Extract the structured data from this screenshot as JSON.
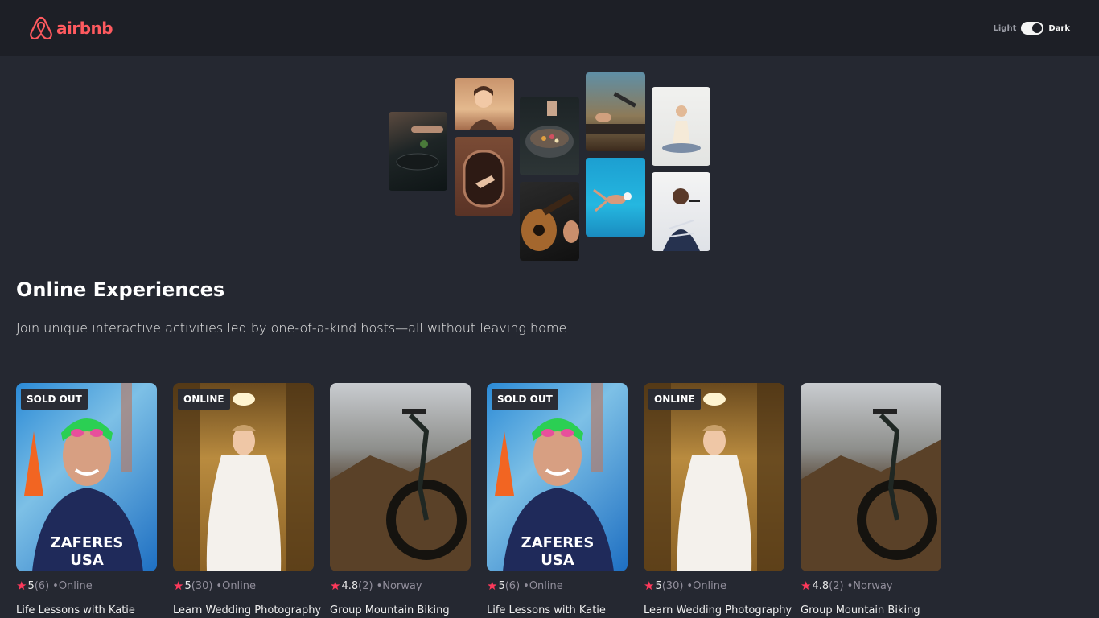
{
  "navbar": {
    "logo_text": "airbnb",
    "toggle_light": "Light",
    "toggle_dark": "Dark"
  },
  "hero": {
    "title": "Online Experiences",
    "subtitle": "Join unique interactive activities led by one-of-a-kind hosts—all without leaving home."
  },
  "cards": [
    {
      "badge": "SOLD OUT",
      "rating": "5",
      "reviews": "(6)",
      "location": "•Online",
      "title": "Life Lessons with Katie"
    },
    {
      "badge": "ONLINE",
      "rating": "5",
      "reviews": "(30)",
      "location": "•Online",
      "title": "Learn Wedding Photography"
    },
    {
      "badge": "",
      "rating": "4.8",
      "reviews": "(2)",
      "location": "•Norway",
      "title": "Group Mountain Biking"
    },
    {
      "badge": "SOLD OUT",
      "rating": "5",
      "reviews": "(6)",
      "location": "•Online",
      "title": "Life Lessons with Katie"
    },
    {
      "badge": "ONLINE",
      "rating": "5",
      "reviews": "(30)",
      "location": "•Online",
      "title": "Learn Wedding Photography"
    },
    {
      "badge": "",
      "rating": "4.8",
      "reviews": "(2)",
      "location": "•Norway",
      "title": "Group Mountain Biking"
    }
  ],
  "colors": {
    "brand": "#ff5a5f",
    "star": "#fe395b",
    "background": "#252831",
    "navbar": "#1d1f26"
  }
}
